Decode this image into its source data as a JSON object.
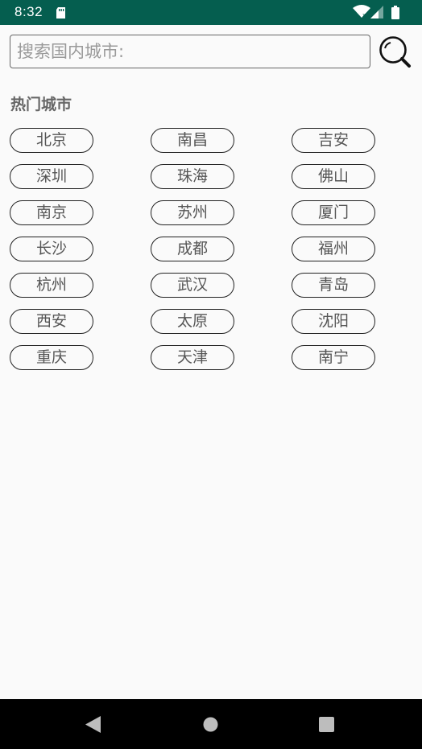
{
  "status_bar": {
    "time": "8:32",
    "background": "#055e4f",
    "icons": [
      "sd-card-icon",
      "wifi-icon",
      "signal-icon",
      "battery-icon"
    ]
  },
  "search": {
    "placeholder": "搜索国内城市:",
    "value": "",
    "icon": "search-icon"
  },
  "hot_cities": {
    "title": "热门城市",
    "cities": [
      "北京",
      "南昌",
      "吉安",
      "深圳",
      "珠海",
      "佛山",
      "南京",
      "苏州",
      "厦门",
      "长沙",
      "成都",
      "福州",
      "杭州",
      "武汉",
      "青岛",
      "西安",
      "太原",
      "沈阳",
      "重庆",
      "天津",
      "南宁"
    ]
  },
  "nav_bar": {
    "icons": [
      "back-icon",
      "home-icon",
      "recents-icon"
    ]
  }
}
